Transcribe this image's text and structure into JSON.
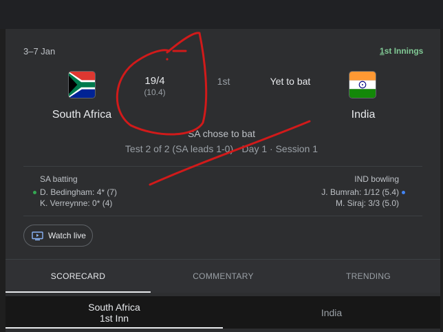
{
  "match": {
    "date": "3–7 Jan",
    "innings_link_first": "1",
    "innings_link_rest": "st Innings",
    "home": {
      "name": "South Africa",
      "score": "19/4",
      "overs": "(10.4)"
    },
    "innings_no": "1st",
    "away": {
      "name": "India",
      "status": "Yet to bat"
    },
    "toss": "SA chose to bat",
    "series_status": "Test 2 of 2 (SA leads 1-0) · Day 1 · Session 1"
  },
  "batting": {
    "label": "SA batting",
    "players": [
      "D. Bedingham: 4* (7)",
      "K. Verreynne: 0* (4)"
    ]
  },
  "bowling": {
    "label": "IND bowling",
    "players": [
      "J. Bumrah: 1/12 (5.4)",
      "M. Siraj: 3/3 (5.0)"
    ]
  },
  "watch": {
    "label": "Watch live",
    "icon": "tv-play-icon"
  },
  "tabs": [
    "SCORECARD",
    "COMMENTARY",
    "TRENDING"
  ],
  "innings_tabs": [
    {
      "line1": "South Africa",
      "line2": "1st Inn"
    },
    {
      "line1": "India",
      "line2": ""
    }
  ],
  "colors": {
    "background": "#2d2e30",
    "innings_link": "#81c995",
    "annotation": "#d11a1a",
    "batting_dot": "#34a853",
    "bowling_dot": "#4285f4"
  }
}
